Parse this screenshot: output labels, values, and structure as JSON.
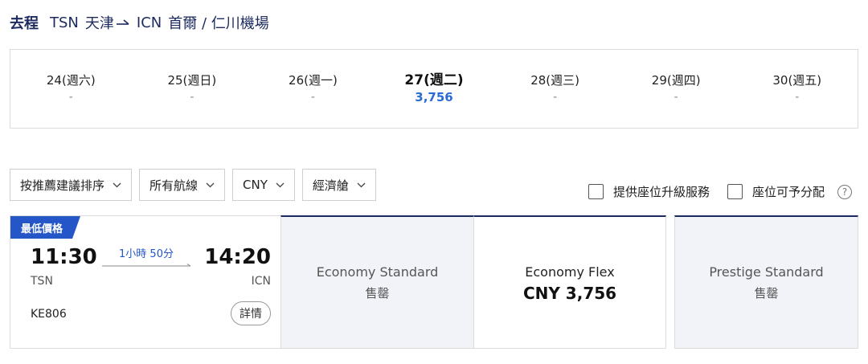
{
  "header": {
    "direction": "去程",
    "origin_code": "TSN",
    "origin_name": "天津",
    "dest_code": "ICN",
    "dest_name": "首爾 / 仁川機場"
  },
  "dates": [
    {
      "label": "24(週六)",
      "price": "-"
    },
    {
      "label": "25(週日)",
      "price": "-"
    },
    {
      "label": "26(週一)",
      "price": "-"
    },
    {
      "label": "27(週二)",
      "price": "3,756"
    },
    {
      "label": "28(週三)",
      "price": "-"
    },
    {
      "label": "29(週四)",
      "price": "-"
    },
    {
      "label": "30(週五)",
      "price": "-"
    }
  ],
  "selected_date_index": 3,
  "filters": {
    "sort": "按推薦建議排序",
    "routes": "所有航線",
    "currency": "CNY",
    "cabin": "經濟艙"
  },
  "options": {
    "upgrade_label": "提供座位升級服務",
    "upgrade_checked": false,
    "seat_assign_label": "座位可予分配",
    "seat_assign_checked": false
  },
  "flight": {
    "badge": "最低價格",
    "departure_time": "11:30",
    "arrival_time": "14:20",
    "duration": "1小時 50分",
    "departure_airport": "TSN",
    "arrival_airport": "ICN",
    "flight_number": "KE806",
    "details_label": "詳情",
    "fares": [
      {
        "name": "Economy Standard",
        "price": "售罄",
        "status": "soldout"
      },
      {
        "name": "Economy Flex",
        "price": "CNY 3,756",
        "status": "available"
      },
      {
        "name": "Prestige Standard",
        "price": "售罄",
        "status": "soldout"
      }
    ]
  },
  "colors": {
    "primary": "#1c2a5e",
    "accent_blue": "#2456c8",
    "price_blue": "#2b6bd6",
    "soldout_bg": "#f1f3f8"
  }
}
